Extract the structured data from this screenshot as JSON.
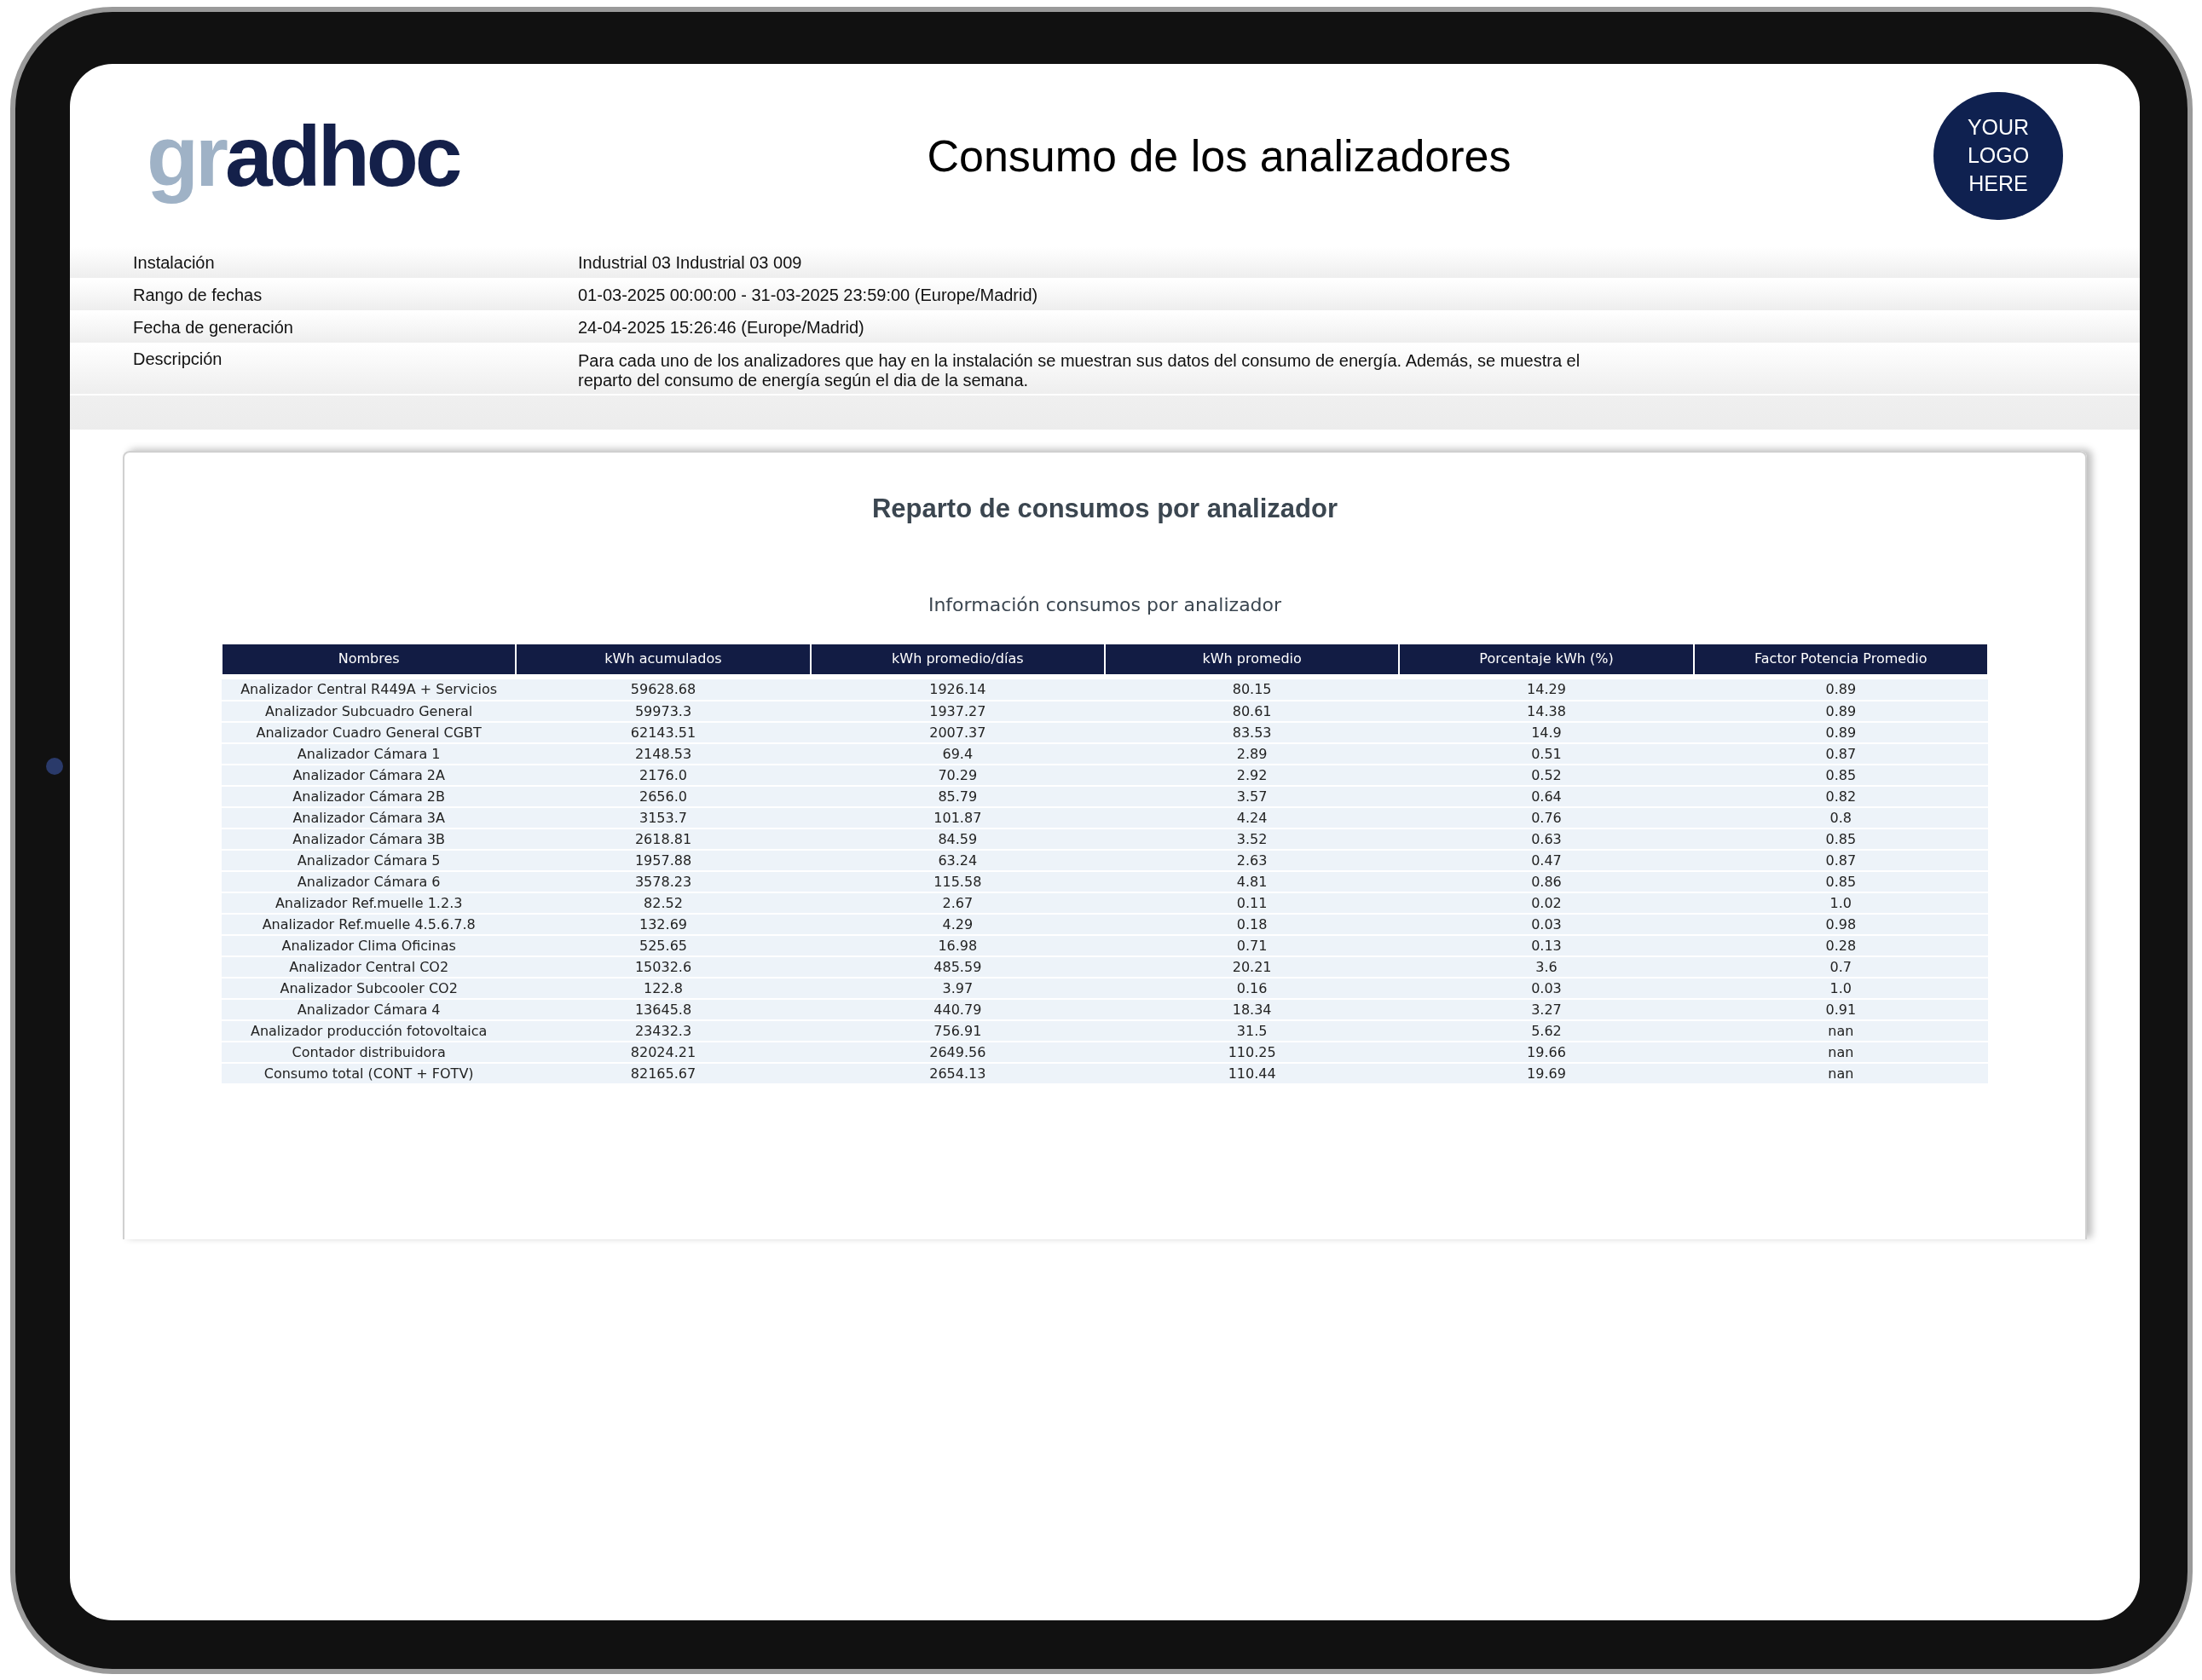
{
  "header": {
    "logo": {
      "light": "gr",
      "dark": "adhoc"
    },
    "title": "Consumo de los analizadores",
    "placeholder_logo": [
      "YOUR",
      "LOGO",
      "HERE"
    ]
  },
  "info": [
    {
      "label": "Instalación",
      "value": "Industrial 03 Industrial 03 009"
    },
    {
      "label": "Rango de fechas",
      "value": "01-03-2025 00:00:00 - 31-03-2025 23:59:00 (Europe/Madrid)"
    },
    {
      "label": "Fecha de generación",
      "value": "24-04-2025 15:26:46 (Europe/Madrid)"
    },
    {
      "label": "Descripción",
      "value": "Para cada uno de los analizadores que hay en la instalación se muestran sus datos del consumo de energía. Además, se muestra el reparto del consumo de energía según el dia de la semana."
    }
  ],
  "card": {
    "title": "Reparto de consumos por analizador",
    "subtitle": "Información consumos por analizador",
    "table": {
      "columns": [
        "Nombres",
        "kWh acumulados",
        "kWh promedio/días",
        "kWh promedio",
        "Porcentaje kWh (%)",
        "Factor Potencia Promedio"
      ],
      "rows": [
        [
          "Analizador Central R449A + Servicios",
          "59628.68",
          "1926.14",
          "80.15",
          "14.29",
          "0.89"
        ],
        [
          "Analizador Subcuadro General",
          "59973.3",
          "1937.27",
          "80.61",
          "14.38",
          "0.89"
        ],
        [
          "Analizador Cuadro General CGBT",
          "62143.51",
          "2007.37",
          "83.53",
          "14.9",
          "0.89"
        ],
        [
          "Analizador Cámara 1",
          "2148.53",
          "69.4",
          "2.89",
          "0.51",
          "0.87"
        ],
        [
          "Analizador Cámara 2A",
          "2176.0",
          "70.29",
          "2.92",
          "0.52",
          "0.85"
        ],
        [
          "Analizador Cámara 2B",
          "2656.0",
          "85.79",
          "3.57",
          "0.64",
          "0.82"
        ],
        [
          "Analizador Cámara 3A",
          "3153.7",
          "101.87",
          "4.24",
          "0.76",
          "0.8"
        ],
        [
          "Analizador Cámara 3B",
          "2618.81",
          "84.59",
          "3.52",
          "0.63",
          "0.85"
        ],
        [
          "Analizador Cámara 5",
          "1957.88",
          "63.24",
          "2.63",
          "0.47",
          "0.87"
        ],
        [
          "Analizador Cámara 6",
          "3578.23",
          "115.58",
          "4.81",
          "0.86",
          "0.85"
        ],
        [
          "Analizador Ref.muelle 1.2.3",
          "82.52",
          "2.67",
          "0.11",
          "0.02",
          "1.0"
        ],
        [
          "Analizador Ref.muelle 4.5.6.7.8",
          "132.69",
          "4.29",
          "0.18",
          "0.03",
          "0.98"
        ],
        [
          "Analizador Clima Oficinas",
          "525.65",
          "16.98",
          "0.71",
          "0.13",
          "0.28"
        ],
        [
          "Analizador Central CO2",
          "15032.6",
          "485.59",
          "20.21",
          "3.6",
          "0.7"
        ],
        [
          "Analizador Subcooler CO2",
          "122.8",
          "3.97",
          "0.16",
          "0.03",
          "1.0"
        ],
        [
          "Analizador Cámara 4",
          "13645.8",
          "440.79",
          "18.34",
          "3.27",
          "0.91"
        ],
        [
          "Analizador producción fotovoltaica",
          "23432.3",
          "756.91",
          "31.5",
          "5.62",
          "nan"
        ],
        [
          "Contador distribuidora",
          "82024.21",
          "2649.56",
          "110.25",
          "19.66",
          "nan"
        ],
        [
          "Consumo total (CONT + FOTV)",
          "82165.67",
          "2654.13",
          "110.44",
          "19.69",
          "nan"
        ]
      ]
    }
  }
}
